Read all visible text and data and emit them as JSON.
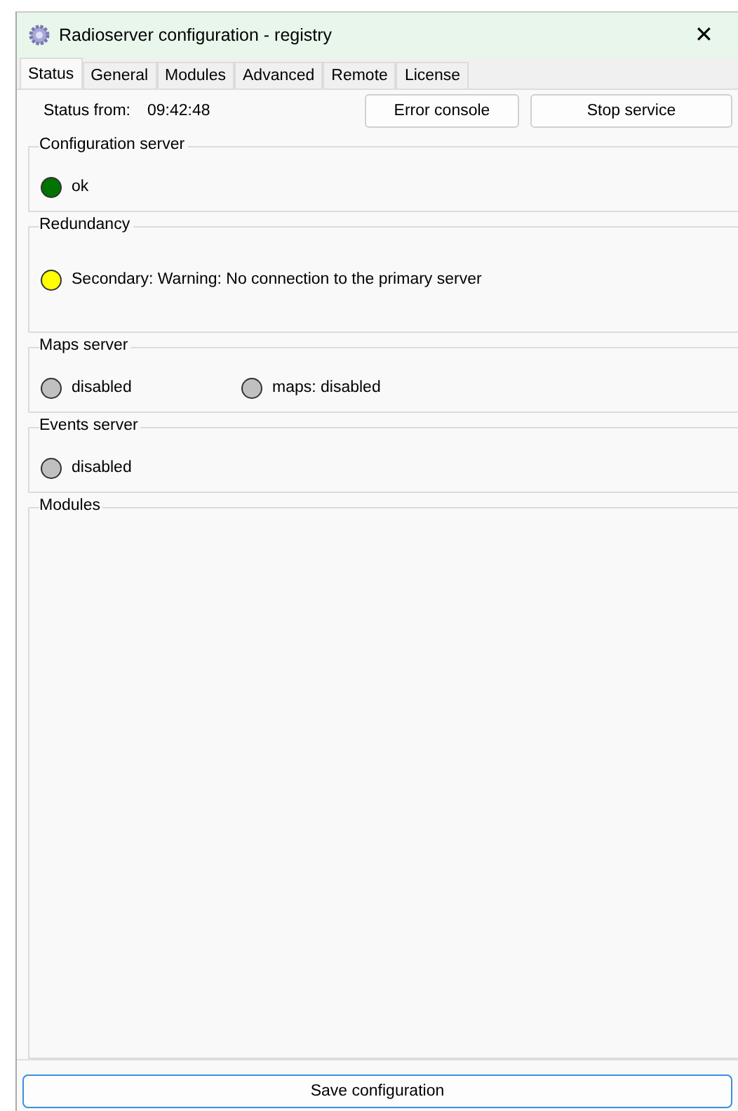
{
  "window": {
    "title": "Radioserver configuration - registry",
    "close": "✕"
  },
  "tabs": [
    {
      "label": "Status",
      "selected": true
    },
    {
      "label": "General",
      "selected": false
    },
    {
      "label": "Modules",
      "selected": false
    },
    {
      "label": "Advanced",
      "selected": false
    },
    {
      "label": "Remote",
      "selected": false
    },
    {
      "label": "License",
      "selected": false
    }
  ],
  "status_from": {
    "label": "Status from:",
    "value": "09:42:48"
  },
  "buttons": [
    "Error console",
    "Stop service"
  ],
  "groups": [
    {
      "title": "Configuration server",
      "kind": "status",
      "items": [
        {
          "text": "ok",
          "color": "#007400"
        }
      ]
    },
    {
      "title": "Redundancy",
      "kind": "tall",
      "items": [
        {
          "text": "Secondary: Warning: No connection to the primary server",
          "color": "#ffff00"
        }
      ]
    },
    {
      "title": "Maps server",
      "kind": "status",
      "items": [
        {
          "text": "disabled",
          "color": "#c0c0c0"
        },
        {
          "text": "maps: disabled",
          "color": "#c0c0c0"
        }
      ]
    },
    {
      "title": "Events server",
      "kind": "status",
      "items": [
        {
          "text": "disabled",
          "color": "#c0c0c0"
        }
      ]
    },
    {
      "title": "Modules",
      "kind": "fill"
    }
  ],
  "save_button": "Save configuration"
}
